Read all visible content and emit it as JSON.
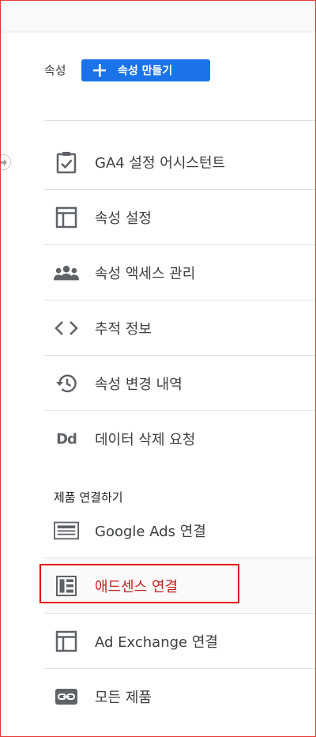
{
  "property": {
    "label": "속성",
    "create_button_label": "속성 만들기"
  },
  "menu": {
    "items": [
      {
        "label": "GA4 설정 어시스턴트",
        "icon": "clipboard-check-icon"
      },
      {
        "label": "속성 설정",
        "icon": "layout-window-icon"
      },
      {
        "label": "속성 액세스 관리",
        "icon": "people-group-icon"
      },
      {
        "label": "추적 정보",
        "icon": "code-brackets-icon"
      },
      {
        "label": "속성 변경 내역",
        "icon": "history-icon"
      },
      {
        "label": "데이터 삭제 요청",
        "icon": "dd-icon",
        "icon_text": "Dd"
      }
    ]
  },
  "linking": {
    "heading": "제품 연결하기",
    "items": [
      {
        "label": "Google Ads 연결",
        "icon": "google-ads-icon"
      },
      {
        "label": "애드센스 연결",
        "icon": "adsense-icon",
        "selected": true
      },
      {
        "label": "Ad Exchange 연결",
        "icon": "layout-window-icon"
      },
      {
        "label": "모든 제품",
        "icon": "link-icon"
      }
    ]
  },
  "colors": {
    "accent": "#1a73e8",
    "selected_text": "#c5221f",
    "highlight_box": "#e00000",
    "icon": "#5f6368"
  }
}
